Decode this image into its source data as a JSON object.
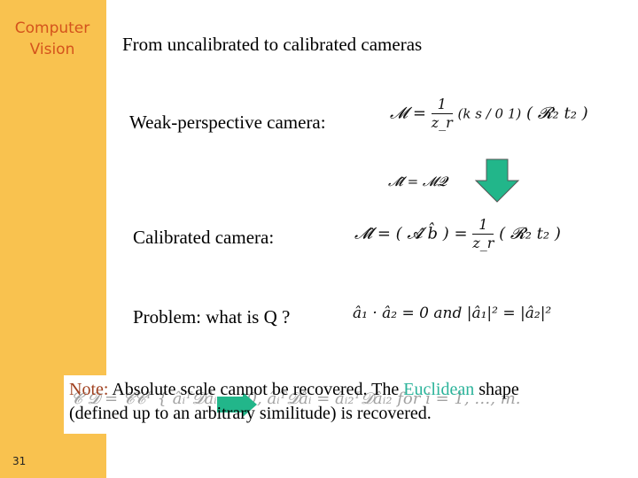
{
  "sidebar": {
    "title_line1": "Computer",
    "title_line2": "Vision",
    "slide_number": "31"
  },
  "slide": {
    "title": "From uncalibrated to calibrated cameras",
    "weak_label": "Weak-perspective camera:",
    "weak_eq": {
      "lhs": "𝓜 =",
      "num": "1",
      "den": "z_r",
      "matrix": "(k  s / 0  1)",
      "tail": "( 𝓡₂   t₂ )"
    },
    "update_eq": "𝓜̂ = 𝓜𝓠",
    "calib_label": "Calibrated camera:",
    "calib_eq": {
      "lhs": "𝓜̂ = ( 𝓐̂   b̂ ) =",
      "num": "1",
      "den": "z_r",
      "tail": "( 𝓡₂   t₂ )"
    },
    "problem_label": "Problem: what is Q ?",
    "problem_eq": "â₁ · â₂ = 0   and   |â₁|² = |â₂|²",
    "note": {
      "prefix": "Note:",
      "text1": " Absolute scale cannot be recovered. The ",
      "highlight": "Euclidean",
      "text2": " shape",
      "line2": "(defined up to an arbitrary similitude) is recovered.",
      "ghost_formula": "𝓒 𝓓 = 𝓒𝓒ᵀ      { âᵢᵀ𝓓âᵢ₂ = 0,  âᵢᵀ𝓓âᵢ = âᵢ₂ᵀ𝓓âᵢ₂   for  i = 1, …, m."
    }
  },
  "colors": {
    "sidebar": "#F9C24F",
    "brand_text": "#D4531C",
    "arrow": "#22B68A",
    "note_prefix": "#A0401F",
    "highlight": "#2BB39A"
  }
}
